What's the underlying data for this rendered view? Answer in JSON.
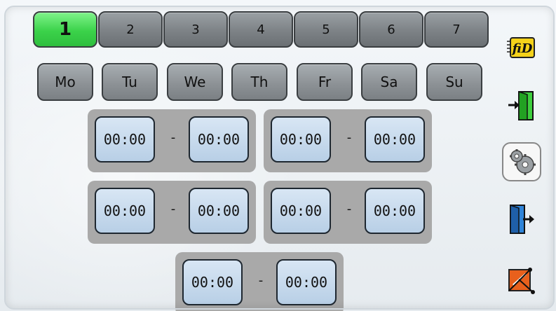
{
  "programs": {
    "tabs": [
      "1",
      "2",
      "3",
      "4",
      "5",
      "6",
      "7"
    ],
    "active_index": 0
  },
  "days": [
    "Mo",
    "Tu",
    "We",
    "Th",
    "Fr",
    "Sa",
    "Su"
  ],
  "time_windows": [
    {
      "start": "00:00",
      "end": "00:00"
    },
    {
      "start": "00:00",
      "end": "00:00"
    },
    {
      "start": "00:00",
      "end": "00:00"
    },
    {
      "start": "00:00",
      "end": "00:00"
    },
    {
      "start": "00:00",
      "end": "00:00"
    }
  ],
  "separator": "-",
  "side_icons": {
    "fid_logo_text": "fiD",
    "items": [
      "fid-logo-icon",
      "login-icon",
      "settings-gears-icon",
      "logout-icon",
      "edit-pen-icon"
    ]
  }
}
